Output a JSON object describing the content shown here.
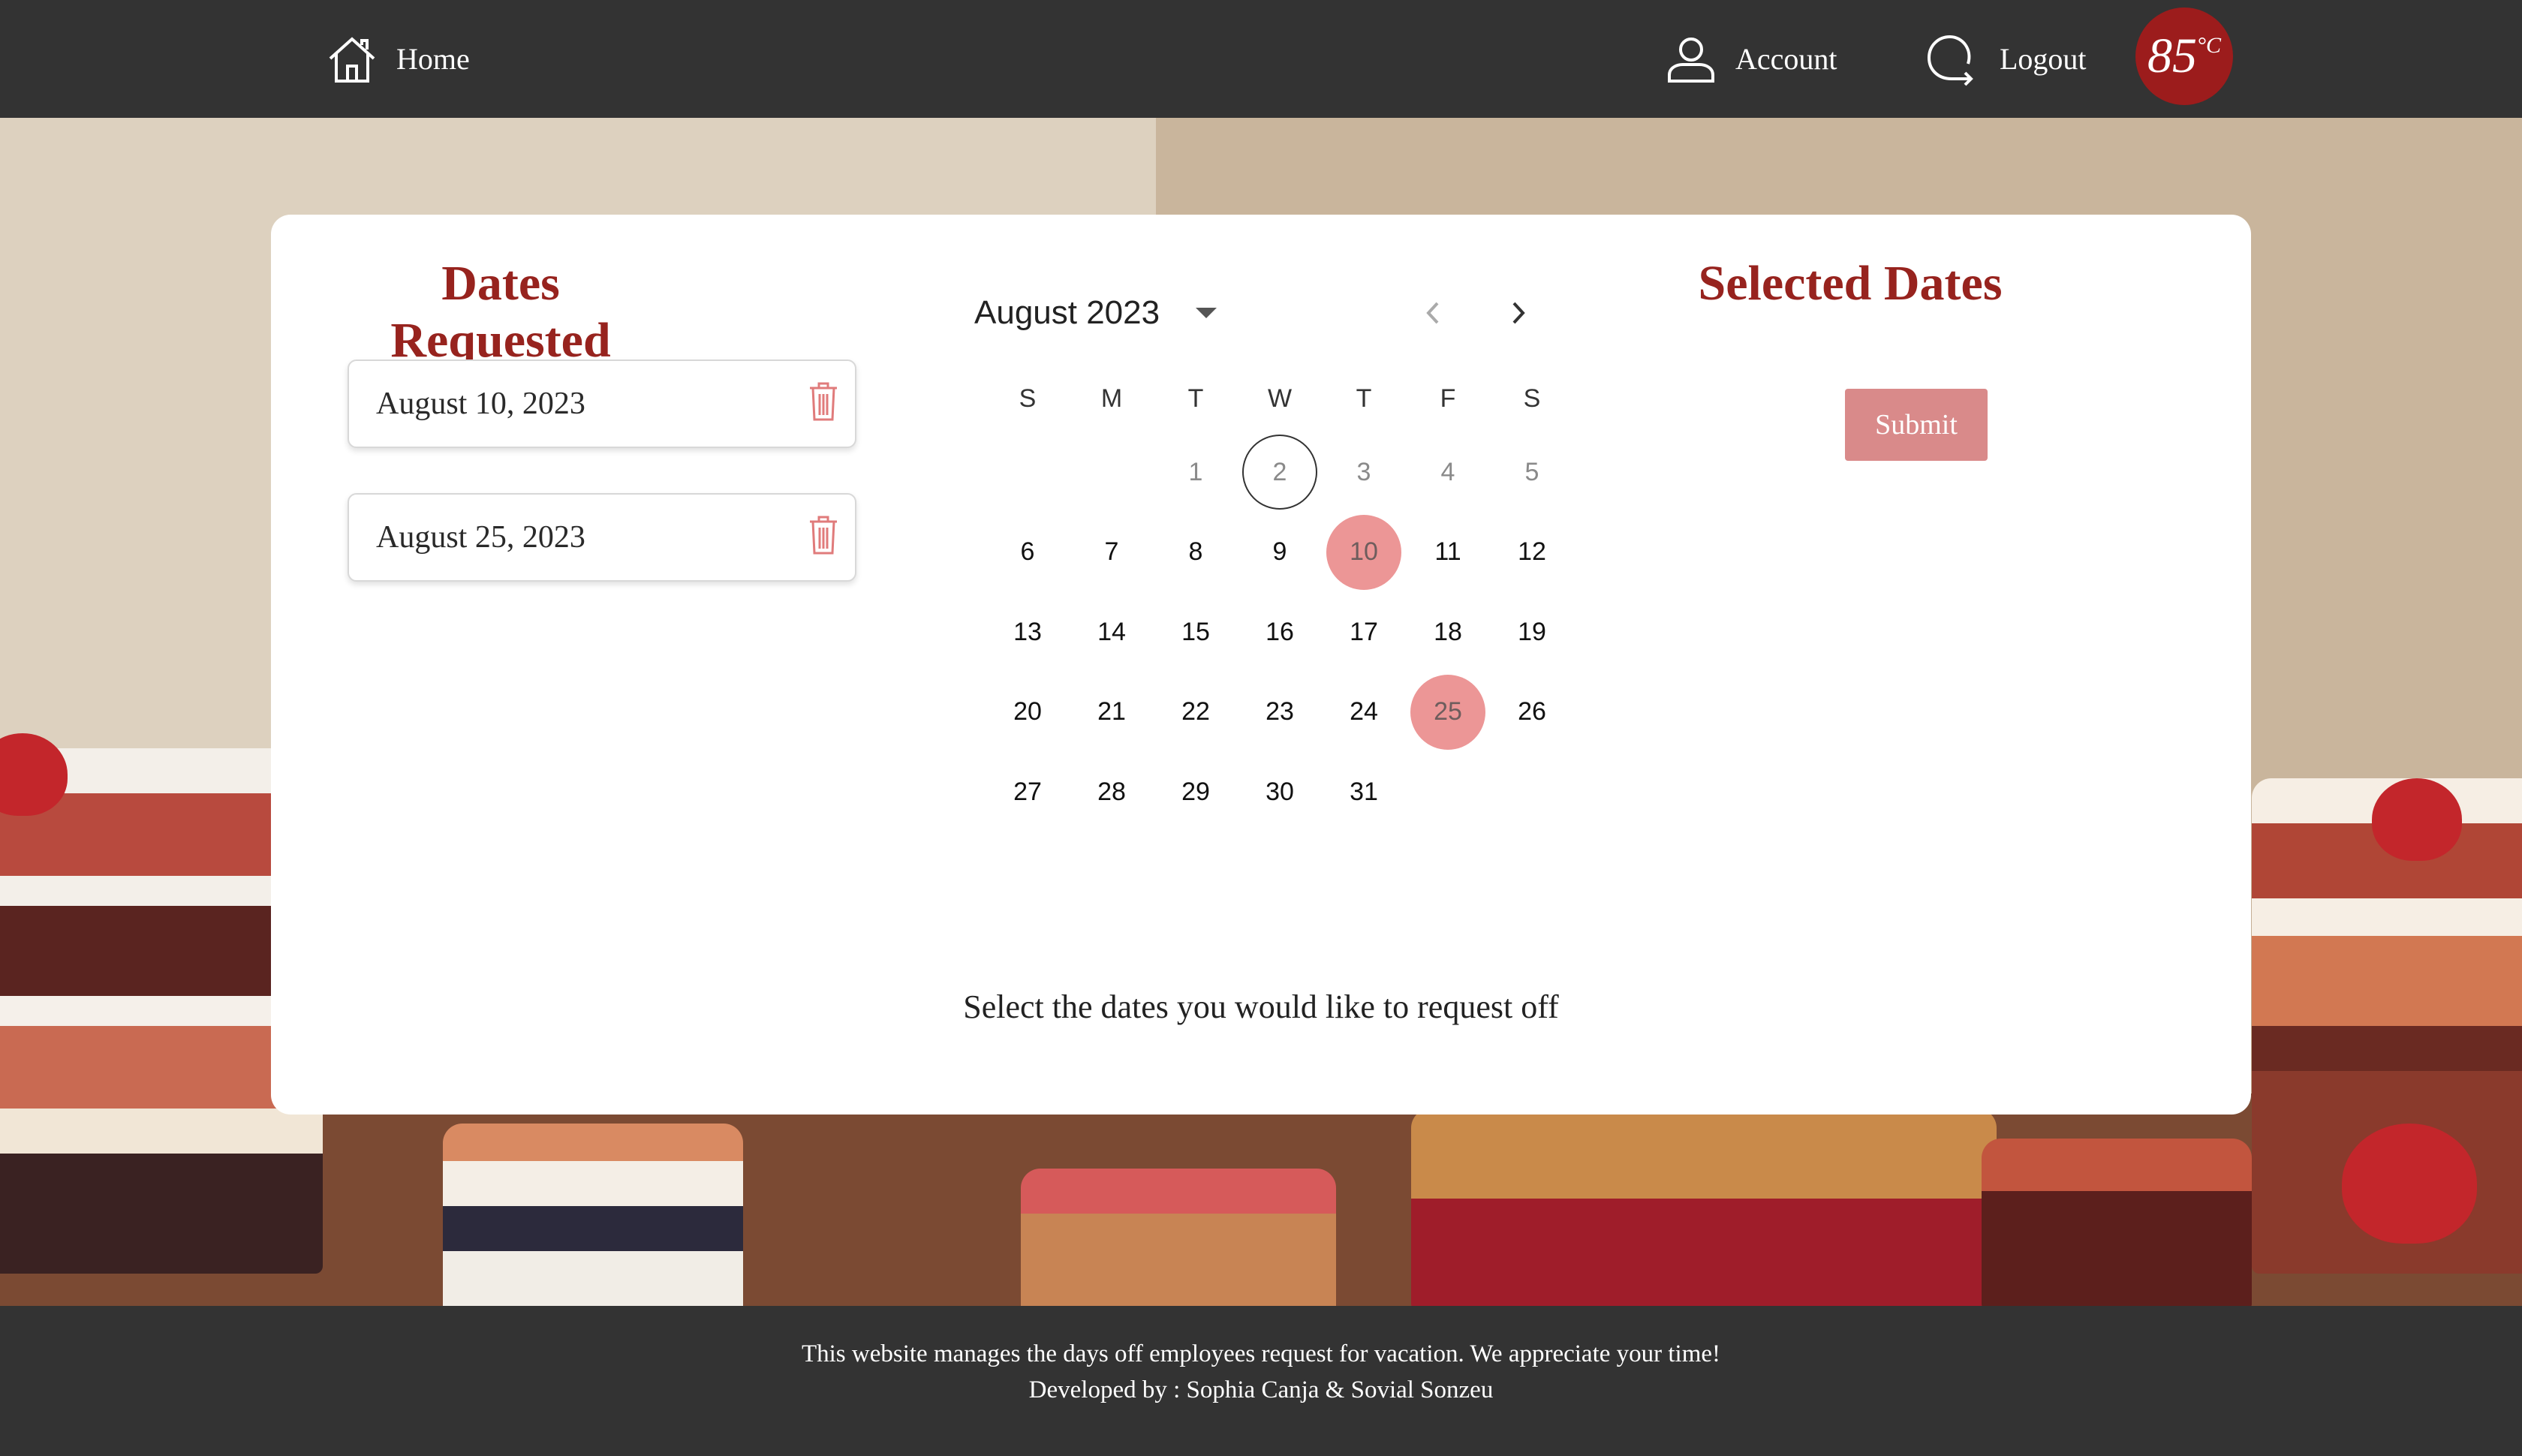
{
  "nav": {
    "home_label": "Home",
    "account_label": "Account",
    "logout_label": "Logout",
    "logo_text": "85",
    "logo_degree": "°C"
  },
  "requested": {
    "title": "Dates Requested",
    "dates": [
      "August 10, 2023",
      "August 25, 2023"
    ]
  },
  "calendar": {
    "month_label": "August 2023",
    "weekdays": [
      "S",
      "M",
      "T",
      "W",
      "T",
      "F",
      "S"
    ],
    "leading_blanks": 2,
    "days_in_month": 31,
    "muted_days": [
      1,
      2,
      3,
      4,
      5
    ],
    "today": 2,
    "selected_days": [
      10,
      25
    ]
  },
  "instruction": "Select the dates you would like to request off",
  "selected": {
    "title": "Selected Dates",
    "submit_label": "Submit"
  },
  "footer": {
    "line1": "This website manages the days off employees request for vacation. We appreciate your time!",
    "line2": "Developed by : Sophia Canja & Sovial Sonzeu"
  },
  "colors": {
    "accent": "#97231e",
    "selected_day": "#ec9696",
    "submit_bg": "#d98a8a",
    "bar_bg": "#333333"
  }
}
